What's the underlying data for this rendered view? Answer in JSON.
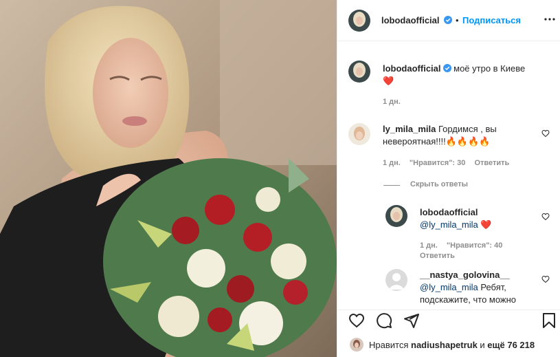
{
  "post": {
    "author": "lobodaofficial",
    "follow_label": "Подписаться",
    "separator": "•",
    "caption": "моё утро в Киеве",
    "caption_emoji": "❤️",
    "caption_time": "1 дн."
  },
  "comments": [
    {
      "user": "ly_mila_mila",
      "text": "Гордимся , вы невероятная!!!!🔥🔥🔥🔥",
      "time": "1 дн.",
      "likes": "\"Нравится\": 30",
      "reply_label": "Ответить"
    }
  ],
  "hide_replies_label": "Скрыть ответы",
  "replies": [
    {
      "user": "lobodaofficial",
      "mention": "@ly_mila_mila",
      "emoji": "❤️",
      "time": "1 дн.",
      "likes": "\"Нравится\": 40",
      "reply_label": "Ответить"
    },
    {
      "user": "__nastya_golovina__",
      "mention": "@ly_mila_mila",
      "text": "Ребят,",
      "text2": "подскажите, что можно"
    }
  ],
  "footer": {
    "likes_prefix": "Нравится",
    "liked_by": "nadiushapetruk",
    "likes_suffix": "и ещё 76 218"
  },
  "colors": {
    "accent": "#0095f6",
    "heart": "#ed4956",
    "muted": "#8e8e8e"
  },
  "icons": [
    "heart-icon",
    "comment-icon",
    "share-icon",
    "bookmark-icon",
    "more-icon",
    "verified-icon"
  ]
}
